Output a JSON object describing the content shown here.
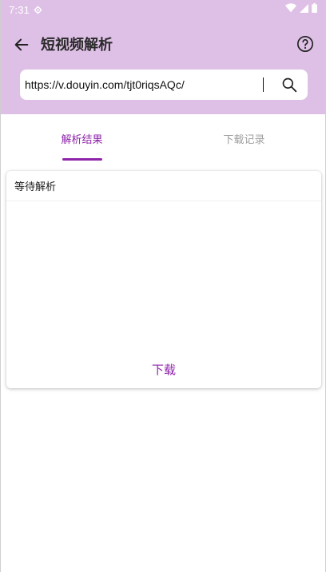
{
  "status_bar": {
    "time": "7:31"
  },
  "app_bar": {
    "title": "短视频解析"
  },
  "search": {
    "value": "https://v.douyin.com/tjt0riqsAQc/"
  },
  "tabs": [
    {
      "label": "解析结果",
      "active": true
    },
    {
      "label": "下载记录",
      "active": false
    }
  ],
  "result_card": {
    "status": "等待解析",
    "download_label": "下载"
  },
  "colors": {
    "header_bg": "#dec0e6",
    "accent": "#8e24aa"
  }
}
